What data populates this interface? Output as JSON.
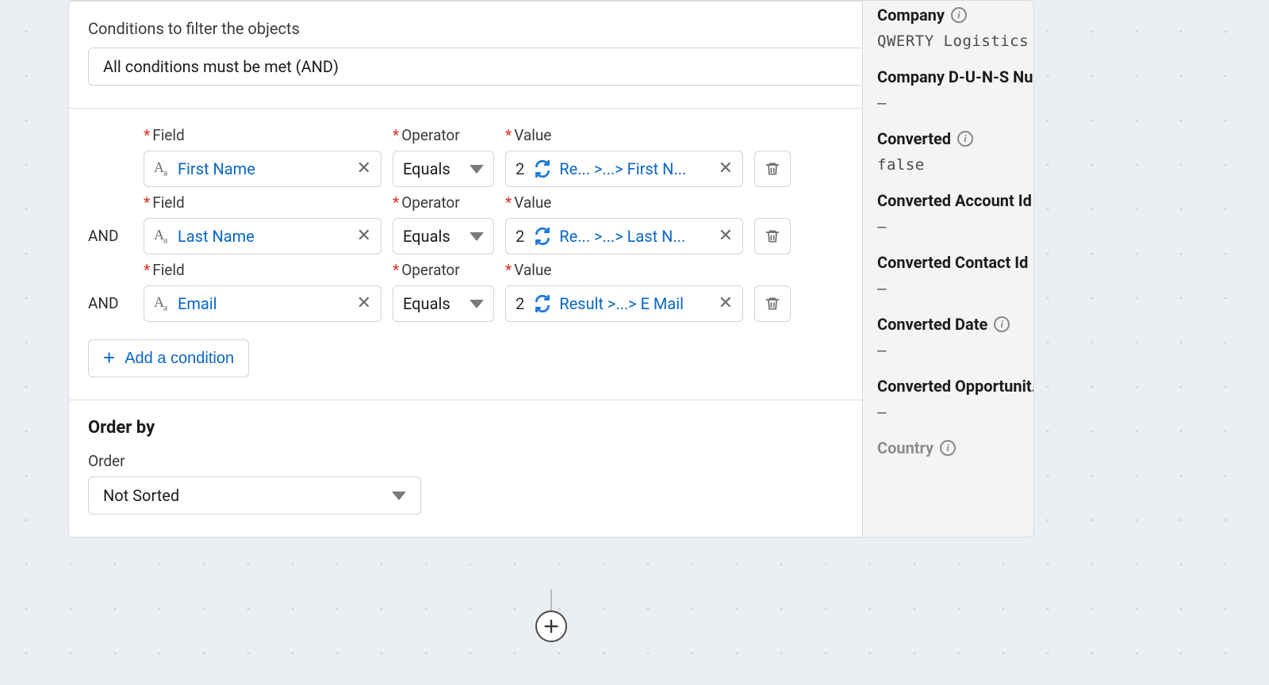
{
  "filter": {
    "conditions_label": "Conditions to filter the objects",
    "logic_selected": "All conditions must be met (AND)",
    "field_label": "Field",
    "operator_label": "Operator",
    "value_label": "Value",
    "and_label": "AND",
    "add_condition_label": "Add a condition",
    "rows": [
      {
        "field": "First Name",
        "operator": "Equals",
        "value_prefix": "2",
        "value_path": "Re...  >...> First N..."
      },
      {
        "field": "Last Name",
        "operator": "Equals",
        "value_prefix": "2",
        "value_path": "Re...  >...> Last N..."
      },
      {
        "field": "Email",
        "operator": "Equals",
        "value_prefix": "2",
        "value_path": "Result >...> E Mail"
      }
    ]
  },
  "orderby": {
    "heading": "Order by",
    "order_label": "Order",
    "order_selected": "Not Sorted"
  },
  "inspector": {
    "props": [
      {
        "label": "Company",
        "value": "QWERTY Logistics",
        "info": true
      },
      {
        "label": "Company D-U-N-S Nu...",
        "value": "–",
        "info": false
      },
      {
        "label": "Converted",
        "value": "false",
        "info": true
      },
      {
        "label": "Converted Account Id",
        "value": "–",
        "info": true
      },
      {
        "label": "Converted Contact Id",
        "value": "–",
        "info": true
      },
      {
        "label": "Converted Date",
        "value": "–",
        "info": true
      },
      {
        "label": "Converted Opportunit...",
        "value": "–",
        "info": false
      },
      {
        "label": "Country",
        "value": "",
        "info": true,
        "muted": true
      }
    ]
  }
}
